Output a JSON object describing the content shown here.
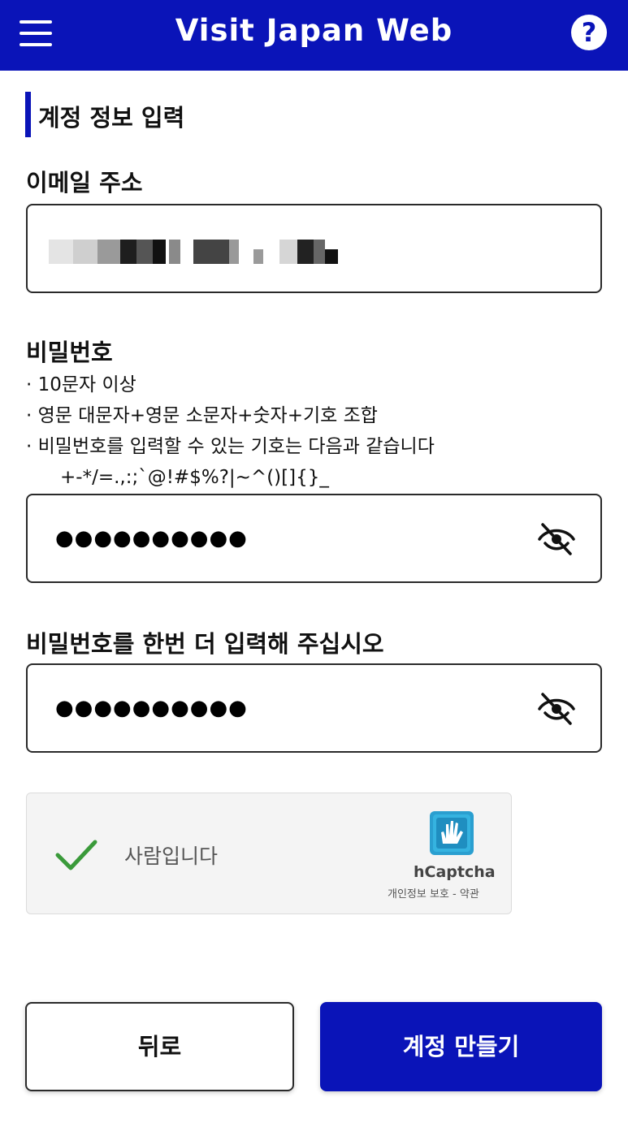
{
  "header": {
    "title": "Visit Japan Web",
    "menu_icon": "hamburger-menu-icon",
    "help_icon": "question-circle-icon",
    "help_glyph": "?",
    "background_color": "#0a14b8"
  },
  "section": {
    "title": "계정 정보 입력"
  },
  "email": {
    "label": "이메일 주소",
    "value_state": "redacted"
  },
  "password": {
    "label": "비밀번호",
    "rules": [
      "· 10문자 이상",
      "· 영문 대문자+영문 소문자+숫자+기호 조합",
      "· 비밀번호를 입력할 수 있는 기호는 다음과 같습니다"
    ],
    "allowed_symbols": "+-*/=.,:;`@!#$%?|~^()[]{}_",
    "masked_value": "●●●●●●●●●●",
    "toggle_icon": "eye-slash-icon"
  },
  "confirm_password": {
    "label": "비밀번호를 한번 더 입력해 주십시오",
    "masked_value": "●●●●●●●●●●",
    "toggle_icon": "eye-slash-icon"
  },
  "captcha": {
    "status_text": "사람입니다",
    "checked": true,
    "check_color": "#3a9a3a",
    "brand": "hCaptcha",
    "privacy_link": "개인정보 보호",
    "separator": " - ",
    "terms_link": "약관"
  },
  "buttons": {
    "back_label": "뒤로",
    "create_label": "계정 만들기",
    "primary_color": "#0a14b8"
  }
}
